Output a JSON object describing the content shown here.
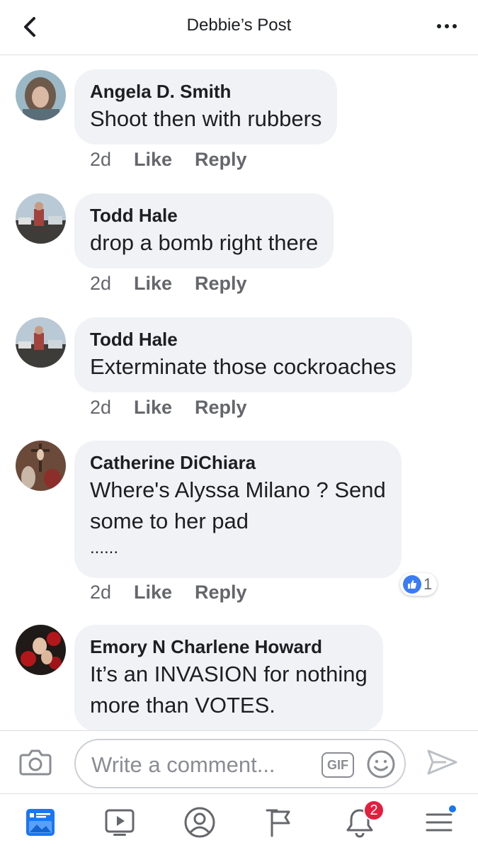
{
  "header": {
    "title": "Debbie’s Post",
    "back_icon": "chevron-left-icon",
    "more_icon": "more-horizontal-icon"
  },
  "comments": [
    {
      "author": "Angela D. Smith",
      "text": "Shoot then with rubbers",
      "time": "2d",
      "like": "Like",
      "reply": "Reply"
    },
    {
      "author": "Todd Hale",
      "text": "drop a bomb right there",
      "time": "2d",
      "like": "Like",
      "reply": "Reply"
    },
    {
      "author": "Todd Hale",
      "text": "Exterminate those cockroaches",
      "time": "2d",
      "like": "Like",
      "reply": "Reply"
    },
    {
      "author": "Catherine DiChiara",
      "text_lines": [
        "Where's Alyssa Milano ? Send",
        "some to her pad",
        "......"
      ],
      "time": "2d",
      "like": "Like",
      "reply": "Reply",
      "reaction_count": "1"
    },
    {
      "author": "Emory N Charlene Howard",
      "text_lines": [
        "It’s an INVASION for nothing",
        "more than VOTES."
      ]
    }
  ],
  "composer": {
    "placeholder": "Write a comment...",
    "gif_label": "GIF"
  },
  "tabbar": {
    "notifications_badge": "2",
    "items": [
      "news-feed-icon",
      "watch-icon",
      "profile-icon",
      "pages-flag-icon",
      "notifications-bell-icon",
      "menu-icon"
    ]
  },
  "colors": {
    "accent": "#1877f2",
    "bubble": "#f0f2f5",
    "badge": "#e41e3f",
    "muted": "#65676b"
  }
}
